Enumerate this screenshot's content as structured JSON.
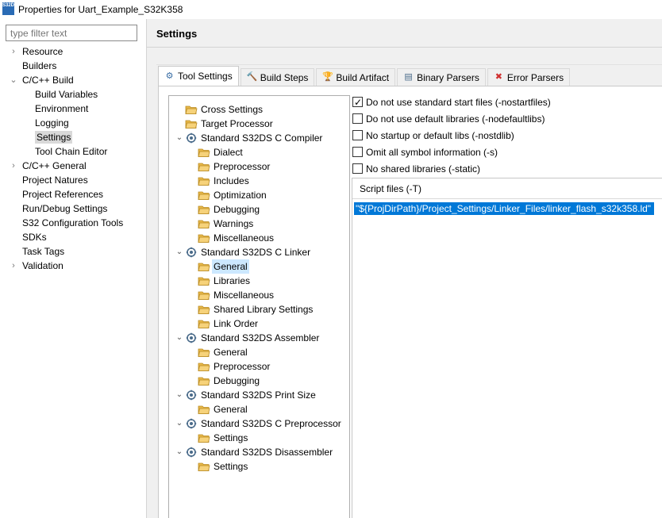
{
  "window": {
    "app_icon_text": "S32DS",
    "title": "Properties for Uart_Example_S32K358"
  },
  "left": {
    "filter_placeholder": "type filter text",
    "items": [
      {
        "label": "Resource",
        "chev": "›",
        "level": 0
      },
      {
        "label": "Builders",
        "chev": "",
        "level": 0
      },
      {
        "label": "C/C++ Build",
        "chev": "⌄",
        "level": 0
      },
      {
        "label": "Build Variables",
        "chev": "",
        "level": 1
      },
      {
        "label": "Environment",
        "chev": "",
        "level": 1
      },
      {
        "label": "Logging",
        "chev": "",
        "level": 1
      },
      {
        "label": "Settings",
        "chev": "",
        "level": 1
      },
      {
        "label": "Tool Chain Editor",
        "chev": "",
        "level": 1
      },
      {
        "label": "C/C++ General",
        "chev": "›",
        "level": 0
      },
      {
        "label": "Project Natures",
        "chev": "",
        "level": 0
      },
      {
        "label": "Project References",
        "chev": "",
        "level": 0
      },
      {
        "label": "Run/Debug Settings",
        "chev": "",
        "level": 0
      },
      {
        "label": "S32 Configuration Tools",
        "chev": "",
        "level": 0
      },
      {
        "label": "SDKs",
        "chev": "",
        "level": 0
      },
      {
        "label": "Task Tags",
        "chev": "",
        "level": 0
      },
      {
        "label": "Validation",
        "chev": "›",
        "level": 0
      }
    ]
  },
  "right": {
    "title": "Settings",
    "tabs": [
      {
        "label": "Tool Settings",
        "icon": "⚙"
      },
      {
        "label": "Build Steps",
        "icon": "🔨"
      },
      {
        "label": "Build Artifact",
        "icon": "🏆"
      },
      {
        "label": "Binary Parsers",
        "icon": "▤"
      },
      {
        "label": "Error Parsers",
        "icon": "✖"
      }
    ],
    "tree": [
      {
        "label": "Cross Settings",
        "type": "folder",
        "level": 0,
        "chev": ""
      },
      {
        "label": "Target Processor",
        "type": "folder",
        "level": 0,
        "chev": ""
      },
      {
        "label": "Standard S32DS C Compiler",
        "type": "tool",
        "level": 0,
        "chev": "⌄"
      },
      {
        "label": "Dialect",
        "type": "folder",
        "level": 1,
        "chev": ""
      },
      {
        "label": "Preprocessor",
        "type": "folder",
        "level": 1,
        "chev": ""
      },
      {
        "label": "Includes",
        "type": "folder",
        "level": 1,
        "chev": ""
      },
      {
        "label": "Optimization",
        "type": "folder",
        "level": 1,
        "chev": ""
      },
      {
        "label": "Debugging",
        "type": "folder",
        "level": 1,
        "chev": ""
      },
      {
        "label": "Warnings",
        "type": "folder",
        "level": 1,
        "chev": ""
      },
      {
        "label": "Miscellaneous",
        "type": "folder",
        "level": 1,
        "chev": ""
      },
      {
        "label": "Standard S32DS C Linker",
        "type": "tool",
        "level": 0,
        "chev": "⌄"
      },
      {
        "label": "General",
        "type": "folder",
        "level": 1,
        "chev": ""
      },
      {
        "label": "Libraries",
        "type": "folder",
        "level": 1,
        "chev": ""
      },
      {
        "label": "Miscellaneous",
        "type": "folder",
        "level": 1,
        "chev": ""
      },
      {
        "label": "Shared Library Settings",
        "type": "folder",
        "level": 1,
        "chev": ""
      },
      {
        "label": "Link Order",
        "type": "folder",
        "level": 1,
        "chev": ""
      },
      {
        "label": "Standard S32DS Assembler",
        "type": "tool",
        "level": 0,
        "chev": "⌄"
      },
      {
        "label": "General",
        "type": "folder",
        "level": 1,
        "chev": ""
      },
      {
        "label": "Preprocessor",
        "type": "folder",
        "level": 1,
        "chev": ""
      },
      {
        "label": "Debugging",
        "type": "folder",
        "level": 1,
        "chev": ""
      },
      {
        "label": "Standard S32DS Print Size",
        "type": "tool",
        "level": 0,
        "chev": "⌄"
      },
      {
        "label": "General",
        "type": "folder",
        "level": 1,
        "chev": ""
      },
      {
        "label": "Standard S32DS C Preprocessor",
        "type": "tool",
        "level": 0,
        "chev": "⌄"
      },
      {
        "label": "Settings",
        "type": "folder",
        "level": 1,
        "chev": ""
      },
      {
        "label": "Standard S32DS Disassembler",
        "type": "tool",
        "level": 0,
        "chev": "⌄"
      },
      {
        "label": "Settings",
        "type": "folder",
        "level": 1,
        "chev": ""
      }
    ],
    "options": [
      {
        "label": "Do not use standard start files (-nostartfiles)",
        "checked": true
      },
      {
        "label": "Do not use default libraries (-nodefaultlibs)",
        "checked": false
      },
      {
        "label": "No startup or default libs (-nostdlib)",
        "checked": false
      },
      {
        "label": "Omit all symbol information (-s)",
        "checked": false
      },
      {
        "label": "No shared libraries (-static)",
        "checked": false
      }
    ],
    "script_files": {
      "header": "Script files (-T)",
      "items": [
        "\"${ProjDirPath}/Project_Settings/Linker_Files/linker_flash_s32k358.ld\""
      ]
    }
  },
  "colors": {
    "selection_blue": "#0078d7",
    "tree_selection": "#cce8ff",
    "nav_selection": "#d9d9d9",
    "folder_yellow": "#e8b84a"
  }
}
